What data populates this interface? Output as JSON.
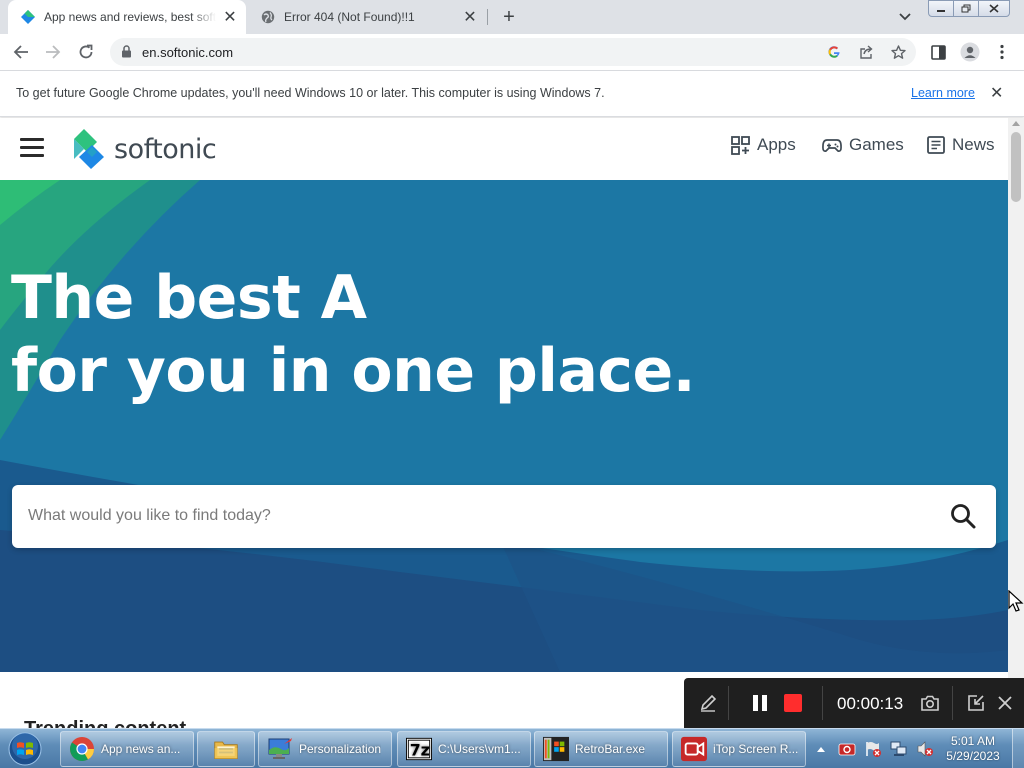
{
  "browser": {
    "tabs": [
      {
        "title": "App news and reviews, best software downloads and discovery - Softonic",
        "active": true,
        "favicon": "softonic-icon"
      },
      {
        "title": "Error 404 (Not Found)!!1",
        "active": false,
        "favicon": "globe-icon"
      }
    ],
    "url": "en.softonic.com",
    "infobar": {
      "message": "To get future Google Chrome updates, you'll need Windows 10 or later. This computer is using Windows 7.",
      "link": "Learn more"
    }
  },
  "site": {
    "logo_text": "softonic",
    "nav": [
      {
        "label": "Apps",
        "icon": "apps-grid-icon"
      },
      {
        "label": "Games",
        "icon": "gamepad-icon"
      },
      {
        "label": "News",
        "icon": "newspaper-icon"
      }
    ],
    "hero": {
      "line1": "The best A",
      "line2": "for you in one place."
    },
    "search": {
      "placeholder": "What would you like to find today?"
    },
    "trending_label": "Trending content"
  },
  "recorder": {
    "timer": "00:00:13"
  },
  "taskbar": {
    "items": [
      {
        "label": "App news an...",
        "icon": "chrome-icon"
      },
      {
        "label": "",
        "icon": "folder-icon"
      },
      {
        "label": "Personalization",
        "icon": "personalization-icon"
      },
      {
        "label": "C:\\Users\\vm1...",
        "icon": "7zip-icon"
      },
      {
        "label": "RetroBar.exe",
        "icon": "retrobar-icon"
      },
      {
        "label": "iTop Screen R...",
        "icon": "itop-recorder-icon"
      }
    ],
    "clock": {
      "time": "5:01 AM",
      "date": "5/29/2023"
    }
  },
  "colors": {
    "hero_blue": "#1c77a4",
    "brand_green": "#2ec27e",
    "brand_blue": "#1e88e5",
    "link_blue": "#1a73e8",
    "record_red": "#ff2d2d"
  }
}
